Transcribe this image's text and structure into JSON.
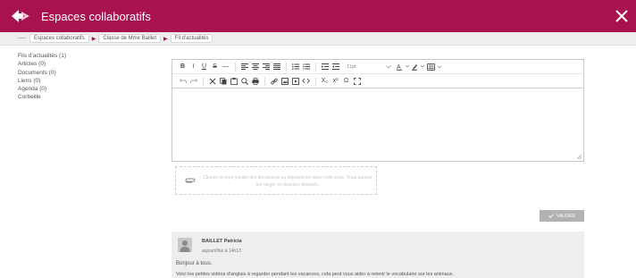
{
  "header": {
    "title": "Espaces collaboratifs",
    "color": "#a8124f"
  },
  "breadcrumb": [
    "Espaces collaboratifs",
    "Classe de Mme Baillet",
    "Fil d'actualités"
  ],
  "sidebar": {
    "items": [
      "Fils d'actualités (1)",
      "Articles (0)",
      "Documents (0)",
      "Liens (0)",
      "Agenda (0)",
      "Corbeille"
    ]
  },
  "editor": {
    "toolbar1": [
      "B",
      "I",
      "U",
      "S",
      "—"
    ],
    "font_size": "11pt",
    "superscript": "x²",
    "subscript": "X₂",
    "omega": "Ω"
  },
  "dropzone": {
    "text": "Cliquez ici pour joindre des documents ou déposez-les dans cette zone. Vous pouvez les ranger en dossiers déposés."
  },
  "submit": {
    "label": "VALIDER"
  },
  "post": {
    "author": "BAILLET Patricia",
    "date": "aujourd'hui à 14h13",
    "greeting": "Bonjour à tous.",
    "body": "Voici les petites vidéos d'anglais à regarder pendant les vacances, cela peut vous aider à retenir le vocabulaire sur les animaux."
  }
}
